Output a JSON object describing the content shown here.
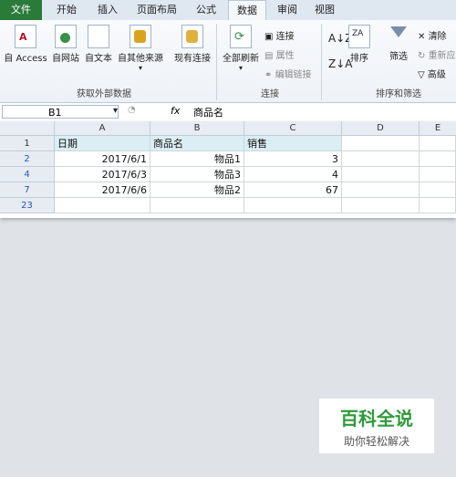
{
  "tabs": [
    "文件",
    "开始",
    "插入",
    "页面布局",
    "公式",
    "数据",
    "审阅",
    "视图"
  ],
  "ribbon": {
    "get_external": [
      "自 Access",
      "自网站",
      "自文本",
      "自其他来源",
      "现有连接"
    ],
    "get_external_group": "获取外部数据",
    "refresh_all": "全部刷新",
    "connections_items": [
      "连接",
      "属性",
      "编辑链接"
    ],
    "connections_group": "连接",
    "sort": "排序",
    "filter": "筛选",
    "clear": "清除",
    "reapply": "重新应",
    "advanced": "高级",
    "sort_filter_group": "排序和筛选"
  },
  "formula_bar": {
    "name_box": "B1",
    "fx": "fx",
    "value": "商品名"
  },
  "sheet": {
    "columns": [
      "A",
      "B",
      "C",
      "D",
      "E"
    ],
    "rows": [
      {
        "num": "1",
        "cells": [
          "日期",
          "商品名",
          "销售"
        ]
      },
      {
        "num": "2",
        "cells": [
          "2017/6/1",
          "物品1",
          "3"
        ]
      },
      {
        "num": "4",
        "cells": [
          "2017/6/3",
          "物品3",
          "4"
        ]
      },
      {
        "num": "7",
        "cells": [
          "2017/6/6",
          "物品2",
          "67"
        ]
      },
      {
        "num": "23",
        "cells": [
          "",
          "",
          ""
        ]
      }
    ]
  },
  "watermark": {
    "title": "百科全说",
    "subtitle": "助你轻松解决"
  },
  "colors": {
    "file_tab": "#2a7a3a",
    "header_fill": "#dbeef3",
    "row_num": "#2b54b5"
  }
}
